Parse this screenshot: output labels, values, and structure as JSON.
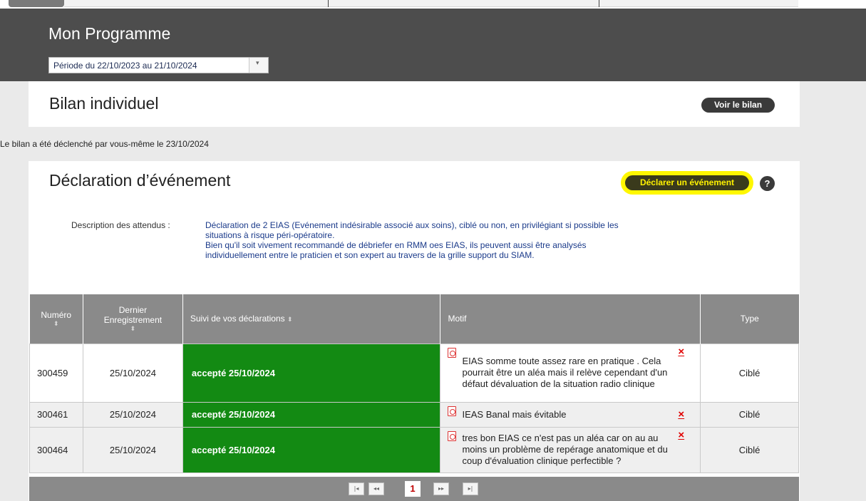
{
  "header": {
    "title": "Mon Programme",
    "period_value": "Période du 22/10/2023 au 21/10/2024",
    "period_arrow": "▾"
  },
  "bilan": {
    "title": "Bilan individuel",
    "view_button": "Voir le bilan",
    "trigger_note": "Le bilan a été déclenché par vous-même le 23/10/2024"
  },
  "declaration": {
    "title": "Déclaration d’événement",
    "declare_button": "Déclarer un événement",
    "help_glyph": "?",
    "description_label": "Description des attendus :",
    "description_lines": [
      "Déclaration de 2 EIAS (Evénement indésirable associé aux soins), ciblé ou non, en privilégiant si possible les",
      "situations à risque péri-opératoire.",
      "Bien qu'il soit vivement recommandé de débriefer en RMM oes EIAS, ils peuvent aussi être analysés",
      "individuellement entre le praticien et son expert au travers de la grille support du SIAM."
    ]
  },
  "table": {
    "headers": {
      "numero": "Numéro",
      "dernier_line1": "Dernier",
      "dernier_line2": "Enregistrement",
      "suivi": "Suivi de vos déclarations",
      "motif": "Motif",
      "type": "Type"
    },
    "sort_glyph": "⬍",
    "delete_glyph": "×",
    "rows": [
      {
        "numero": "300459",
        "date": "25/10/2024",
        "suivi": "accepté 25/10/2024",
        "motif": "EIAS somme toute assez rare en pratique . Cela pourrait être un aléa mais il relève cependant d'un défaut dévaluation de la situation radio clinique",
        "type": "Ciblé"
      },
      {
        "numero": "300461",
        "date": "25/10/2024",
        "suivi": "accepté 25/10/2024",
        "motif": "IEAS Banal mais évitable",
        "type": "Ciblé"
      },
      {
        "numero": "300464",
        "date": "25/10/2024",
        "suivi": "accepté 25/10/2024",
        "motif": "tres bon EIAS ce n'est pas un aléa car on au au moins un problème de repérage anatomique et du coup d'évaluation clinique perfectible ?",
        "type": "Ciblé"
      }
    ]
  },
  "pagination": {
    "first": "|◂",
    "prev": "◂◂",
    "current": "1",
    "next": "▸▸",
    "last": "▸|"
  },
  "colors": {
    "header_bg": "#4d4d4d",
    "accepted_green": "#138a13",
    "highlight_yellow": "#fff700",
    "table_header_gray": "#8a8a8a",
    "delete_red": "#e00000"
  }
}
